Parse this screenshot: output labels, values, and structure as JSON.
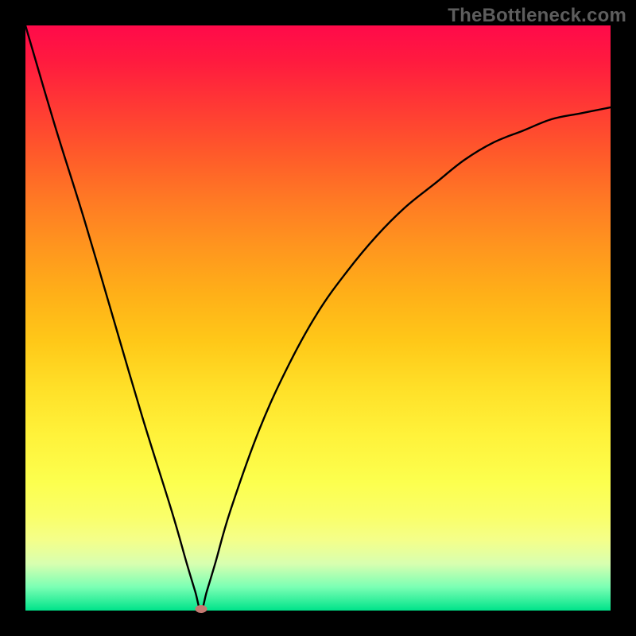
{
  "watermark": "TheBottleneck.com",
  "chart_data": {
    "type": "line",
    "title": "",
    "xlabel": "",
    "ylabel": "",
    "x": [
      0.0,
      0.05,
      0.1,
      0.15,
      0.2,
      0.25,
      0.275,
      0.29,
      0.3,
      0.31,
      0.325,
      0.35,
      0.4,
      0.45,
      0.5,
      0.55,
      0.6,
      0.65,
      0.7,
      0.75,
      0.8,
      0.85,
      0.9,
      0.95,
      1.0
    ],
    "values": [
      1.0,
      0.83,
      0.67,
      0.5,
      0.33,
      0.17,
      0.083,
      0.033,
      0.0,
      0.033,
      0.083,
      0.17,
      0.31,
      0.42,
      0.51,
      0.58,
      0.64,
      0.69,
      0.73,
      0.77,
      0.8,
      0.82,
      0.84,
      0.85,
      0.86
    ],
    "xlim": [
      0,
      1
    ],
    "ylim": [
      0,
      1
    ],
    "min_point": {
      "x": 0.3,
      "y": 0.0
    },
    "background": "rainbow_gradient_vertical_red_to_green"
  },
  "colors": {
    "frame": "#000000",
    "curve": "#000000",
    "marker": "#c47a72",
    "watermark": "#5d5d5d"
  }
}
